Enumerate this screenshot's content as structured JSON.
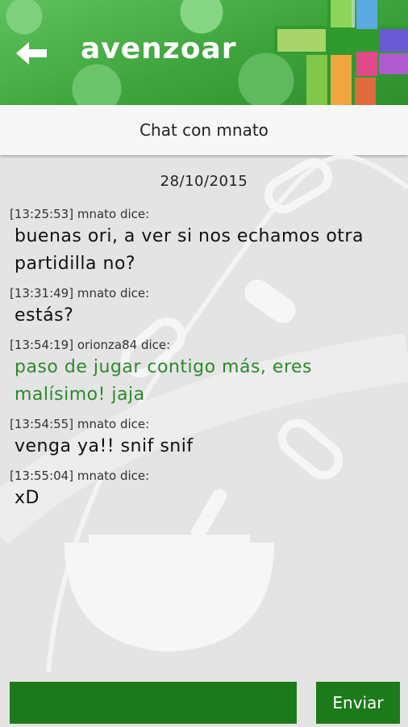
{
  "app": {
    "title": "avenzoar"
  },
  "header": {
    "back_icon": "arrow-left-icon",
    "logo_icon": "pharmacy-cross-logo"
  },
  "chat": {
    "title": "Chat con mnato",
    "date": "28/10/2015",
    "messages": [
      {
        "meta": "[13:25:53] mnato dice:",
        "text": "buenas ori, a ver si nos echamos otra partidilla no?"
      },
      {
        "meta": "[13:31:49] mnato dice:",
        "text": "estás?"
      },
      {
        "meta": "[13:54:19] orionza84 dice:",
        "text": "paso de jugar contigo más, eres malísimo! jaja"
      },
      {
        "meta": "[13:54:55] mnato dice:",
        "text": "venga ya!! snif snif"
      },
      {
        "meta": "[13:55:04] mnato dice:",
        "text": "xD"
      }
    ]
  },
  "composer": {
    "input_value": "",
    "send_label": "Enviar"
  },
  "colors": {
    "header_green": "#3da33b",
    "button_green": "#1d7a1b",
    "own_message": "#2b8a2a"
  }
}
